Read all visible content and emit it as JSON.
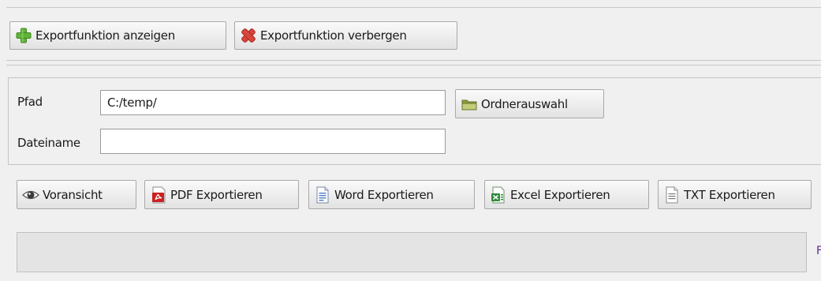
{
  "toolbar": {
    "show_export_label": "Exportfunktion anzeigen",
    "hide_export_label": "Exportfunktion verbergen"
  },
  "form": {
    "path_label": "Pfad",
    "path_value": "C:/temp/",
    "folder_button_label": "Ordnerauswahl",
    "filename_label": "Dateiname",
    "filename_value": ""
  },
  "export_buttons": {
    "preview": "Voransicht",
    "pdf": "PDF Exportieren",
    "word": "Word Exportieren",
    "excel": "Excel Exportieren",
    "txt": "TXT Exportieren"
  },
  "status": {
    "text": "",
    "edge_glyph": "F"
  },
  "icons": {
    "show_export": "plus-icon",
    "hide_export": "x-icon",
    "folder": "folder-icon",
    "preview": "eye-icon",
    "pdf": "pdf-icon",
    "word": "word-document-icon",
    "excel": "excel-document-icon",
    "txt": "text-document-icon"
  },
  "colors": {
    "plus_green": "#5fb336",
    "x_red": "#d8453a",
    "pdf_red": "#cc1f1f",
    "excel_green": "#2e8b3a",
    "word_blue": "#5a86c6",
    "folder_olive": "#a9b35a",
    "edge_glyph_purple": "#5a2a8a"
  }
}
